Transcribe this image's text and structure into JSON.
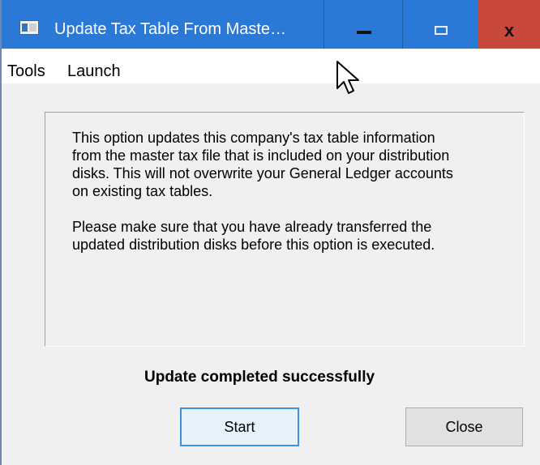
{
  "window": {
    "title": "Update Tax Table From Maste…",
    "buttons": {
      "minimize_icon": "minimize-icon",
      "maximize_icon": "maximize-icon",
      "close_label": "x"
    }
  },
  "menu": {
    "items": [
      {
        "label": "Tools"
      },
      {
        "label": "Launch"
      }
    ]
  },
  "info": {
    "paragraph1": "This option updates this company's tax table information from the master tax file that is included on your distribution disks. This will not overwrite your General Ledger accounts on existing tax tables.",
    "paragraph2": "Please make sure that you have already transferred the updated distribution disks before this option is executed."
  },
  "status": {
    "message": "Update completed successfully"
  },
  "buttons": {
    "start": "Start",
    "close": "Close"
  },
  "colors": {
    "titlebar": "#2b79d6",
    "close_button": "#c9483d",
    "dialog_background": "#f0f0f0",
    "primary_button_border": "#3f8fe2"
  }
}
